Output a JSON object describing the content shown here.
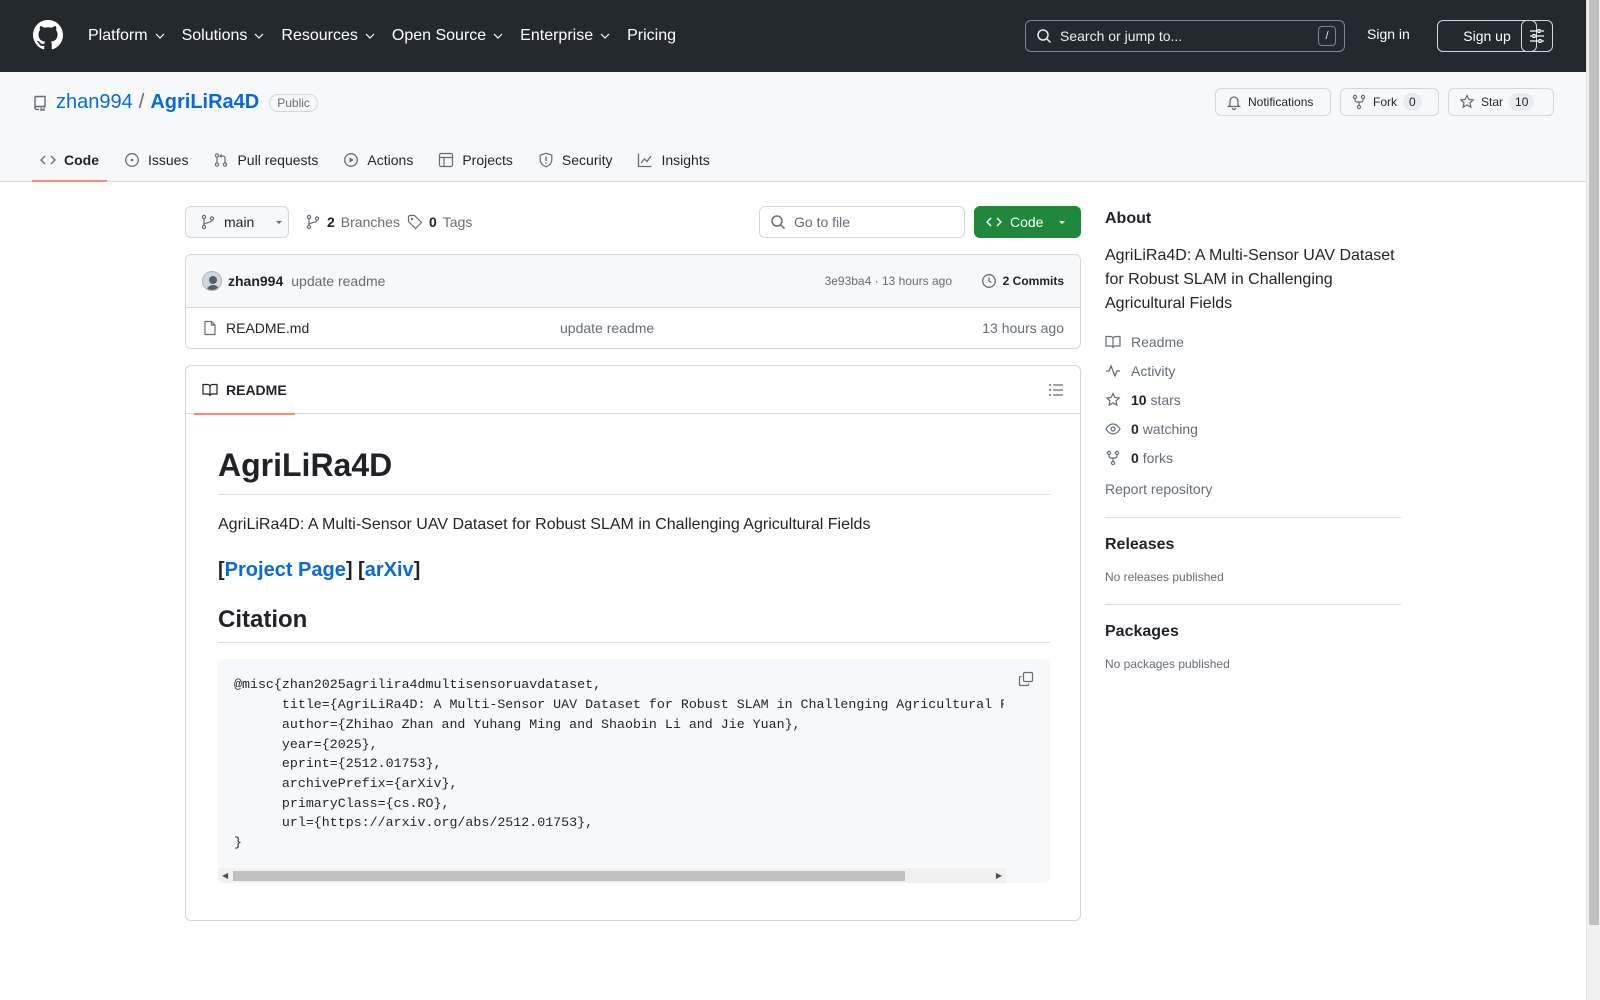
{
  "header": {
    "nav": [
      "Platform",
      "Solutions",
      "Resources",
      "Open Source",
      "Enterprise",
      "Pricing"
    ],
    "search_placeholder": "Search or jump to...",
    "search_shortcut": "/",
    "sign_in": "Sign in",
    "sign_up": "Sign up"
  },
  "repo": {
    "owner": "zhan994",
    "separator": "/",
    "name": "AgriLiRa4D",
    "visibility": "Public",
    "notifications_label": "Notifications",
    "fork_label": "Fork",
    "fork_count": "0",
    "star_label": "Star",
    "star_count": "10",
    "tabs": [
      "Code",
      "Issues",
      "Pull requests",
      "Actions",
      "Projects",
      "Security",
      "Insights"
    ]
  },
  "branch": {
    "current": "main",
    "branches_count": "2",
    "branches_label": "Branches",
    "tags_count": "0",
    "tags_label": "Tags",
    "goto_placeholder": "Go to file",
    "code_button": "Code"
  },
  "commit": {
    "author": "zhan994",
    "message": "update readme",
    "meta": "3e93ba4 · 13 hours ago",
    "commits_label": "2 Commits"
  },
  "files": [
    {
      "name": "README.md",
      "message": "update readme",
      "age": "13 hours ago"
    }
  ],
  "readme": {
    "tab_label": "README",
    "title": "AgriLiRa4D",
    "description": "AgriLiRa4D: A Multi-Sensor UAV Dataset for Robust SLAM in Challenging Agricultural Fields",
    "link_open1": "[",
    "link_project": "Project Page",
    "link_mid": "] [",
    "link_arxiv": "arXiv",
    "link_close": "]",
    "citation_heading": "Citation",
    "citation_code": "@misc{zhan2025agrilira4dmultisensoruavdataset,\n      title={AgriLiRa4D: A Multi-Sensor UAV Dataset for Robust SLAM in Challenging Agricultural Fields},\n      author={Zhihao Zhan and Yuhang Ming and Shaobin Li and Jie Yuan},\n      year={2025},\n      eprint={2512.01753},\n      archivePrefix={arXiv},\n      primaryClass={cs.RO},\n      url={https://arxiv.org/abs/2512.01753},\n}"
  },
  "sidebar": {
    "about_title": "About",
    "about_desc": "AgriLiRa4D: A Multi-Sensor UAV Dataset for Robust SLAM in Challenging Agricultural Fields",
    "readme_label": "Readme",
    "activity_label": "Activity",
    "stars_count": "10",
    "stars_label": "stars",
    "watching_count": "0",
    "watching_label": "watching",
    "forks_count": "0",
    "forks_label": "forks",
    "report_label": "Report repository",
    "releases_title": "Releases",
    "releases_empty": "No releases published",
    "packages_title": "Packages",
    "packages_empty": "No packages published"
  }
}
